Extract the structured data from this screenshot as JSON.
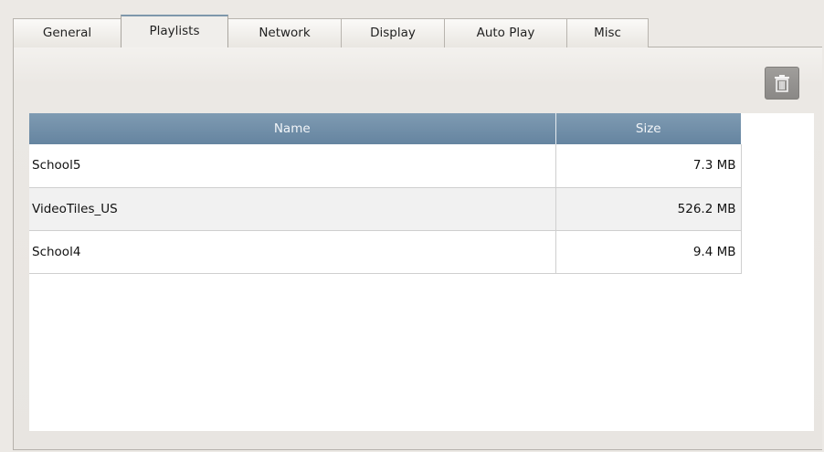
{
  "tabs": [
    {
      "label": "General",
      "active": false
    },
    {
      "label": "Playlists",
      "active": true
    },
    {
      "label": "Network",
      "active": false
    },
    {
      "label": "Display",
      "active": false
    },
    {
      "label": "Auto Play",
      "active": false
    },
    {
      "label": "Misc",
      "active": false
    }
  ],
  "toolbar": {
    "delete_icon": "trash-icon"
  },
  "table": {
    "columns": [
      "Name",
      "Size"
    ],
    "rows": [
      {
        "name": "School5",
        "size": "7.3 MB"
      },
      {
        "name": "VideoTiles_US",
        "size": "526.2 MB"
      },
      {
        "name": "School4",
        "size": "9.4 MB"
      }
    ]
  },
  "colors": {
    "header": "#7390a9",
    "active_tab_accent": "#7e97ab",
    "delete_button": "#959391"
  }
}
